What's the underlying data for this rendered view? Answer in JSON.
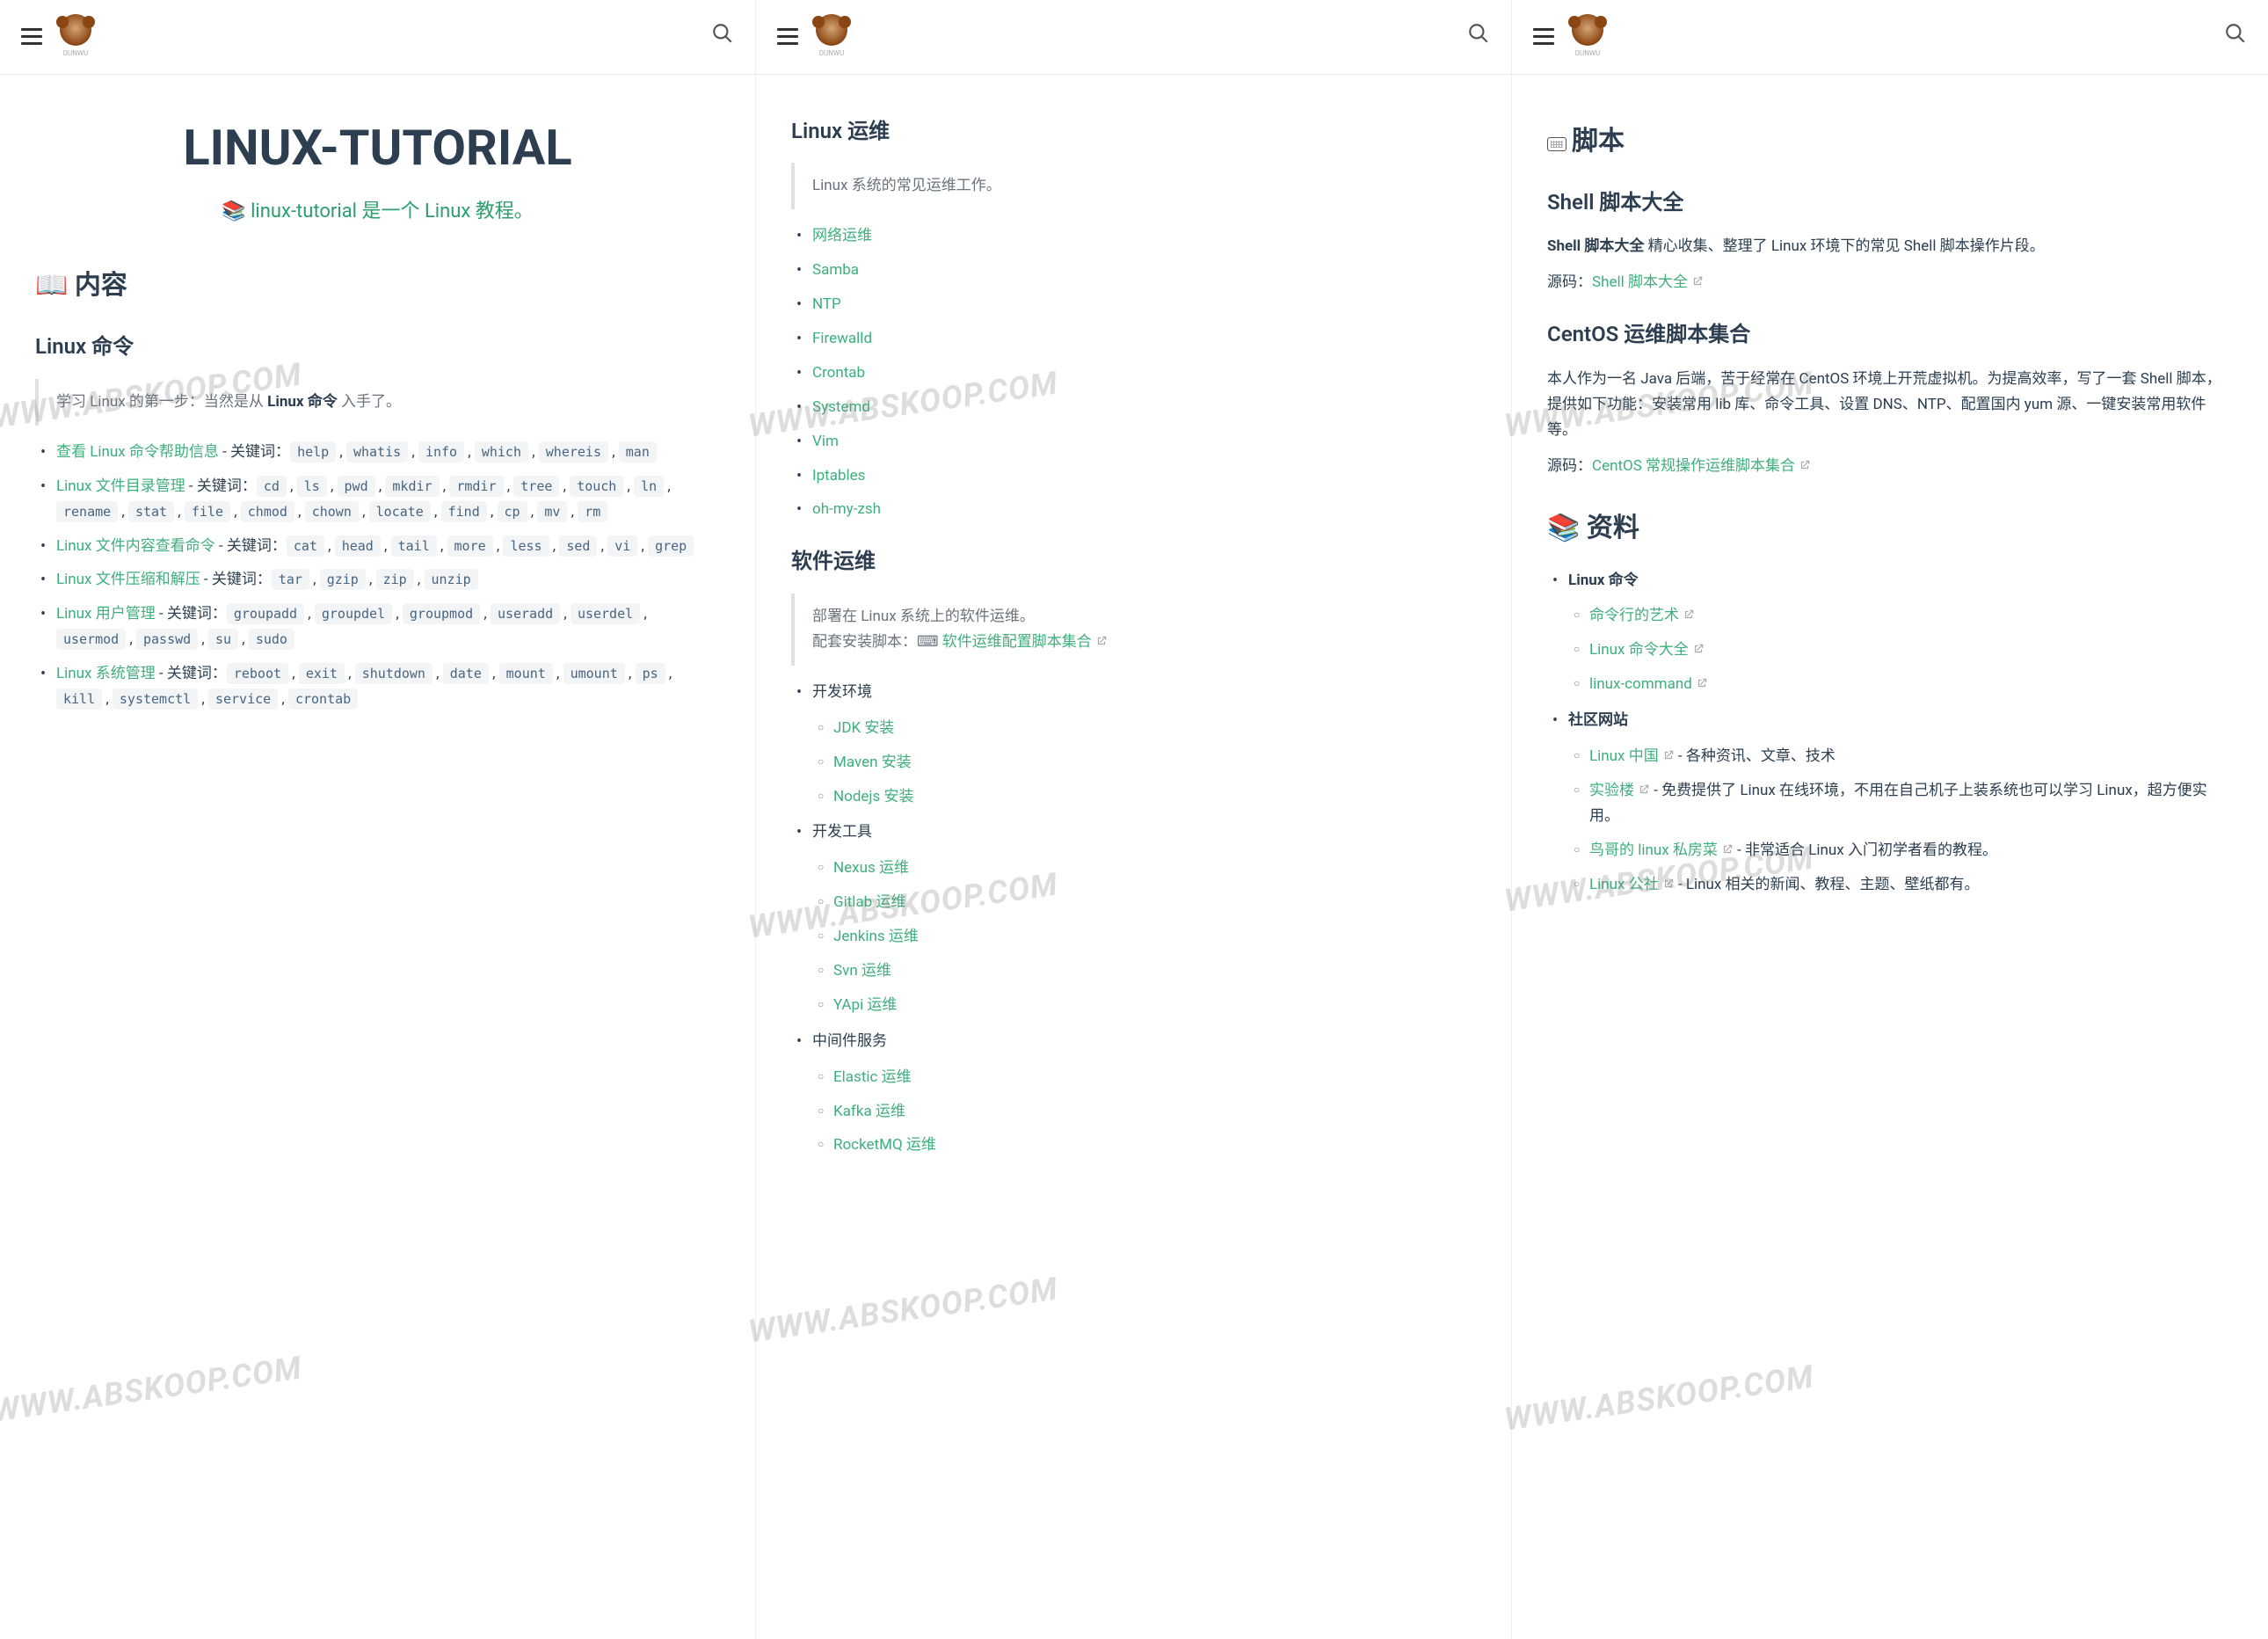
{
  "logo_text": "DUNWU",
  "watermark": "WWW.ABSKOOP.COM",
  "col1": {
    "title": "LINUX-TUTORIAL",
    "subtitle_emoji": "📚",
    "subtitle": "linux-tutorial 是一个 Linux 教程。",
    "contents_heading_emoji": "📖",
    "contents_heading": "内容",
    "sec1_heading": "Linux 命令",
    "sec1_quote_pre": "学习 Linux 的第一步：当然是从 ",
    "sec1_quote_bold": "Linux 命令",
    "sec1_quote_post": " 入手了。",
    "items": [
      {
        "link": "查看 Linux 命令帮助信息",
        "codes": [
          "help",
          "whatis",
          "info",
          "which",
          "whereis",
          "man"
        ]
      },
      {
        "link": "Linux 文件目录管理",
        "codes": [
          "cd",
          "ls",
          "pwd",
          "mkdir",
          "rmdir",
          "tree",
          "touch",
          "ln",
          "rename",
          "stat",
          "file",
          "chmod",
          "chown",
          "locate",
          "find",
          "cp",
          "mv",
          "rm"
        ]
      },
      {
        "link": "Linux 文件内容查看命令",
        "codes": [
          "cat",
          "head",
          "tail",
          "more",
          "less",
          "sed",
          "vi",
          "grep"
        ]
      },
      {
        "link": "Linux 文件压缩和解压",
        "codes": [
          "tar",
          "gzip",
          "zip",
          "unzip"
        ]
      },
      {
        "link": "Linux 用户管理",
        "codes": [
          "groupadd",
          "groupdel",
          "groupmod",
          "useradd",
          "userdel",
          "usermod",
          "passwd",
          "su",
          "sudo"
        ]
      },
      {
        "link": "Linux 系统管理",
        "codes": [
          "reboot",
          "exit",
          "shutdown",
          "date",
          "mount",
          "umount",
          "ps",
          "kill",
          "systemctl",
          "service",
          "crontab"
        ]
      }
    ],
    "kw_label": " - 关键词："
  },
  "col2": {
    "heading_ops": "Linux 运维",
    "ops_quote": "Linux 系统的常见运维工作。",
    "ops_links": [
      "网络运维",
      "Samba",
      "NTP",
      "Firewalld",
      "Crontab",
      "Systemd",
      "Vim",
      "Iptables",
      "oh-my-zsh"
    ],
    "heading_soft": "软件运维",
    "soft_quote_l1": "部署在 Linux 系统上的软件运维。",
    "soft_quote_l2_pre": "配套安装脚本：",
    "soft_quote_l2_link": "软件运维配置脚本集合",
    "soft_quote_emoji": "⌨",
    "groups": [
      {
        "label": "开发环境",
        "items": [
          "JDK 安装",
          "Maven 安装",
          "Nodejs 安装"
        ]
      },
      {
        "label": "开发工具",
        "items": [
          "Nexus 运维",
          "Gitlab 运维",
          "Jenkins 运维",
          "Svn 运维",
          "YApi 运维"
        ]
      },
      {
        "label": "中间件服务",
        "items": [
          "Elastic 运维",
          "Kafka 运维",
          "RocketMQ 运维"
        ]
      }
    ]
  },
  "col3": {
    "heading_script": "脚本",
    "shell_heading": "Shell 脚本大全",
    "shell_p_bold": "Shell 脚本大全",
    "shell_p_rest": " 精心收集、整理了 Linux 环境下的常见 Shell 脚本操作片段。",
    "src_label": "源码：",
    "shell_src_link": "Shell 脚本大全",
    "centos_heading": "CentOS 运维脚本集合",
    "centos_p": "本人作为一名 Java 后端，苦于经常在 CentOS 环境上开荒虚拟机。为提高效率，写了一套 Shell 脚本，提供如下功能：安装常用 lib 库、命令工具、设置 DNS、NTP、配置国内 yum 源、一键安装常用软件等。",
    "centos_src_link": "CentOS 常规操作运维脚本集合",
    "resources_emoji": "📚",
    "resources_heading": "资料",
    "res_g1_label": "Linux 命令",
    "res_g1": [
      {
        "link": "命令行的艺术",
        "desc": ""
      },
      {
        "link": "Linux 命令大全",
        "desc": ""
      },
      {
        "link": "linux-command",
        "desc": ""
      }
    ],
    "res_g2_label": "社区网站",
    "res_g2": [
      {
        "link": "Linux 中国",
        "desc": " - 各种资讯、文章、技术"
      },
      {
        "link": "实验楼",
        "desc": " - 免费提供了 Linux 在线环境，不用在自己机子上装系统也可以学习 Linux，超方便实用。"
      },
      {
        "link": "鸟哥的 linux 私房菜",
        "desc": " - 非常适合 Linux 入门初学者看的教程。"
      },
      {
        "link": "Linux 公社",
        "desc": " - Linux 相关的新闻、教程、主题、壁纸都有。"
      }
    ]
  }
}
